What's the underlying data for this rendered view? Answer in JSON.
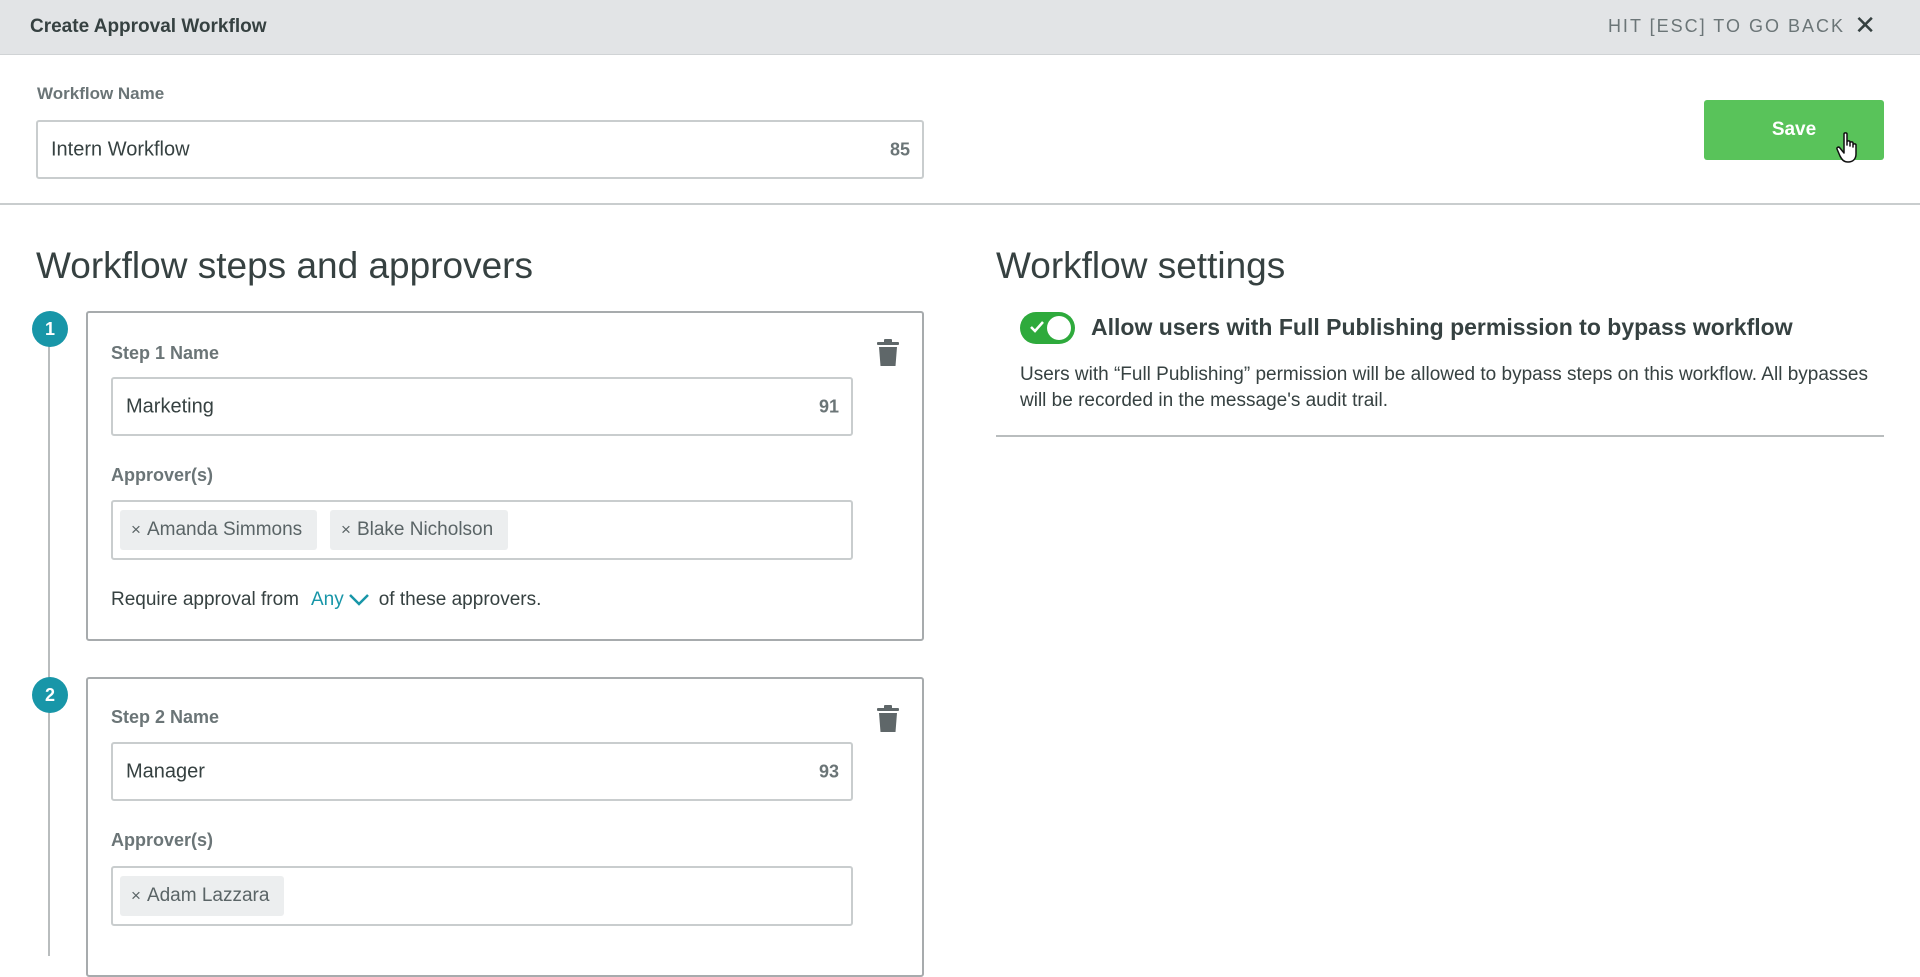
{
  "header": {
    "title": "Create Approval Workflow",
    "back_hint": "HIT [ESC] TO GO BACK",
    "close_glyph": "✕"
  },
  "workflow": {
    "name_label": "Workflow Name",
    "name_value": "Intern Workflow",
    "name_char_count": "85",
    "save_label": "Save"
  },
  "steps_section": {
    "heading": "Workflow steps and approvers",
    "steps": [
      {
        "number": "1",
        "name_label": "Step 1 Name",
        "name_value": "Marketing",
        "name_char_count": "91",
        "approvers_label": "Approver(s)",
        "approvers": [
          "Amanda Simmons",
          "Blake Nicholson"
        ],
        "require_prefix": "Require approval from",
        "require_value": "Any",
        "require_suffix": "of these approvers."
      },
      {
        "number": "2",
        "name_label": "Step 2 Name",
        "name_value": "Manager",
        "name_char_count": "93",
        "approvers_label": "Approver(s)",
        "approvers": [
          "Adam Lazzara"
        ]
      }
    ]
  },
  "settings_section": {
    "heading": "Workflow settings",
    "bypass_toggle_on": true,
    "bypass_title": "Allow users with Full Publishing permission to bypass workflow",
    "bypass_description": "Users with “Full Publishing” permission will be allowed to bypass steps on this workflow. All bypasses will be recorded in the message's audit trail."
  },
  "colors": {
    "accent": "#1896a8",
    "save_button": "#59c35a",
    "toggle_on": "#2eaa3c"
  },
  "icons": {
    "close": "close-icon",
    "delete": "trash-icon",
    "dropdown": "chevron-down-icon",
    "toggle_check": "check-icon",
    "cursor": "hand-pointer-icon"
  }
}
